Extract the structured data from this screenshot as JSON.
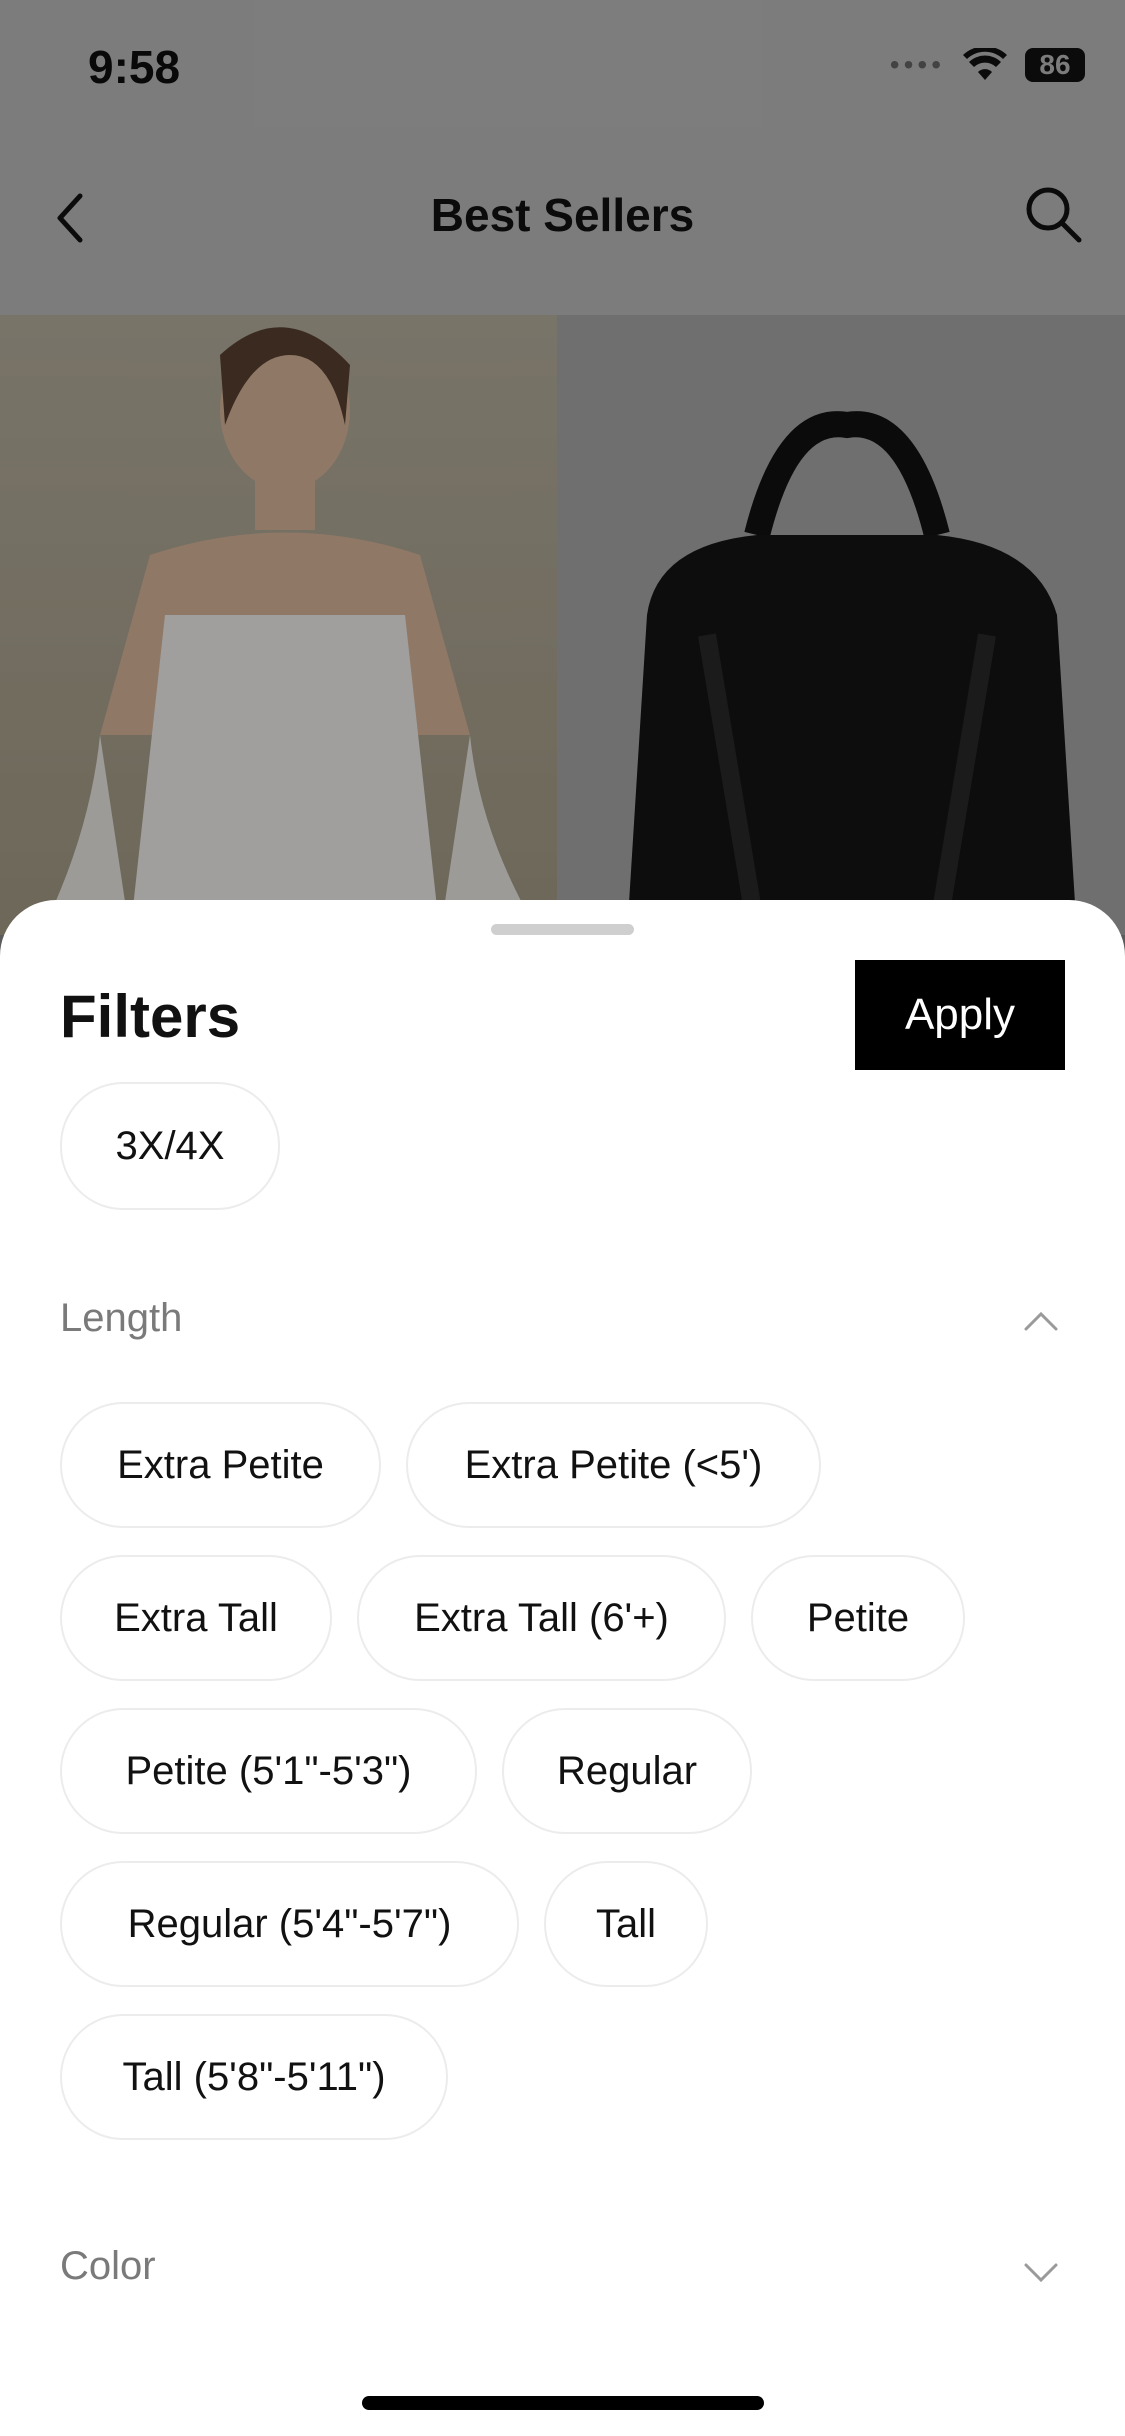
{
  "status_bar": {
    "time": "9:58",
    "battery": "86"
  },
  "nav": {
    "title": "Best Sellers"
  },
  "sheet": {
    "title": "Filters",
    "apply_label": "Apply",
    "size_chip": "3X/4X",
    "length": {
      "label": "Length",
      "options": [
        "Extra Petite",
        "Extra Petite (<5')",
        "Extra Tall",
        "Extra Tall (6'+)",
        "Petite",
        "Petite (5'1\"-5'3\")",
        "Regular",
        "Regular (5'4\"-5'7\")",
        "Tall",
        "Tall (5'8\"-5'11\")"
      ]
    },
    "color": {
      "label": "Color"
    }
  }
}
